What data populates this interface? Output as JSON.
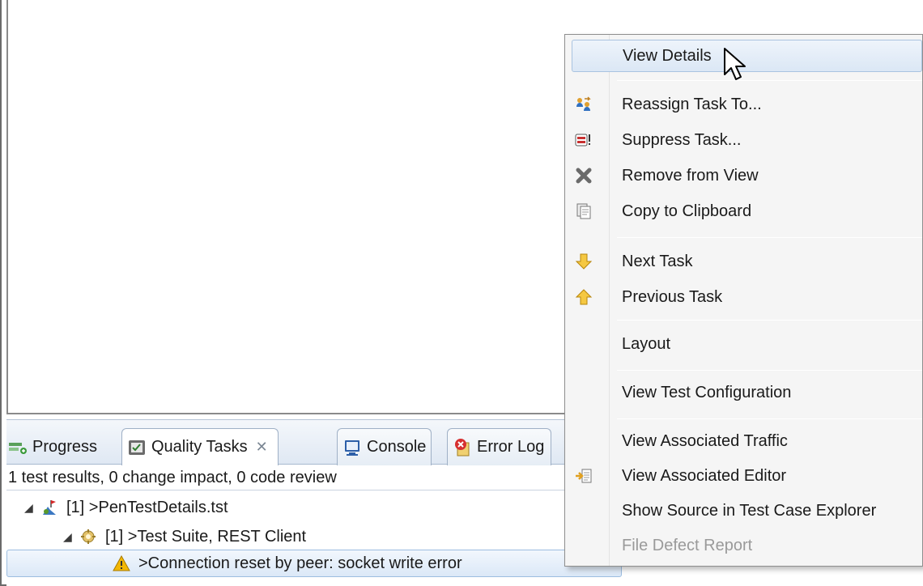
{
  "panel": {
    "tabs": [
      {
        "label": "Progress",
        "icon": "progress-icon"
      },
      {
        "label": "Quality Tasks",
        "icon": "quality-tasks-icon",
        "active": true,
        "close": "✕"
      },
      {
        "label": "Console",
        "icon": "console-icon"
      },
      {
        "label": "Error Log",
        "icon": "error-log-icon"
      }
    ],
    "summary": "1 test results, 0 change impact, 0 code review"
  },
  "tree": [
    {
      "label": "[1] >PenTestDetails.tst",
      "icon": "test-file-icon",
      "expanded": true
    },
    {
      "label": "[1] >Test Suite, REST Client",
      "icon": "test-suite-icon",
      "expanded": true
    },
    {
      "label": ">Connection reset by peer: socket write error",
      "icon": "warning-icon",
      "selected": true
    }
  ],
  "menu": {
    "items": [
      {
        "label": "View Details",
        "icon": ""
      },
      {
        "label": "Reassign Task To...",
        "icon": "reassign-icon"
      },
      {
        "label": "Suppress Task...",
        "icon": "suppress-icon"
      },
      {
        "label": "Remove from View",
        "icon": "remove-icon"
      },
      {
        "label": "Copy to Clipboard",
        "icon": "clipboard-icon"
      },
      {
        "label": "Next Task",
        "icon": "arrow-down-icon"
      },
      {
        "label": "Previous Task",
        "icon": "arrow-up-icon"
      },
      {
        "label": "Layout",
        "icon": ""
      },
      {
        "label": "View Test Configuration",
        "icon": ""
      },
      {
        "label": "View Associated Traffic",
        "icon": ""
      },
      {
        "label": "View Associated Editor",
        "icon": "editor-icon"
      },
      {
        "label": "Show Source in Test Case Explorer",
        "icon": ""
      },
      {
        "label": "File Defect Report",
        "icon": "",
        "disabled": true
      }
    ]
  },
  "colors": {
    "selection_border": "#9cbde0",
    "selection_fill": "#dbe8f7",
    "menu_bg": "#f5f5f5",
    "warning": "#f2b705",
    "arrow": "#f0b020"
  }
}
